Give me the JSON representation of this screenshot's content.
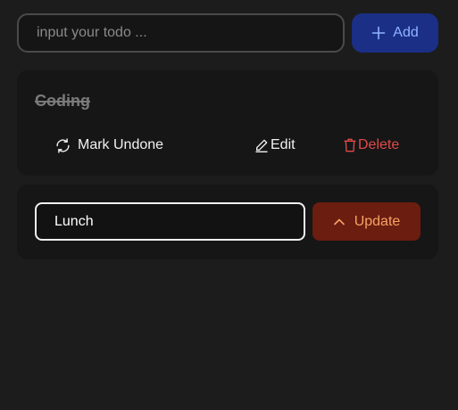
{
  "new_todo": {
    "placeholder": "input your todo ...",
    "value": ""
  },
  "add_button": {
    "label": "Add",
    "icon": "plus-icon",
    "color": "#8fb4ff",
    "background": "#1b2f86"
  },
  "todos": [
    {
      "title": "Coding",
      "done": true,
      "actions": {
        "toggle_label": "Mark Undone",
        "toggle_icon": "refresh-icon",
        "edit_label": "Edit",
        "edit_icon": "pencil-icon",
        "delete_label": "Delete",
        "delete_icon": "trash-icon"
      }
    },
    {
      "editing": true,
      "edit_value": "Lunch",
      "update_label": "Update",
      "update_icon": "chevron-up-icon"
    }
  ],
  "colors": {
    "background": "#1c1c1c",
    "card": "#161616",
    "delete": "#e04a4a",
    "update_bg": "#6b1d10",
    "update_text": "#f7a364"
  }
}
